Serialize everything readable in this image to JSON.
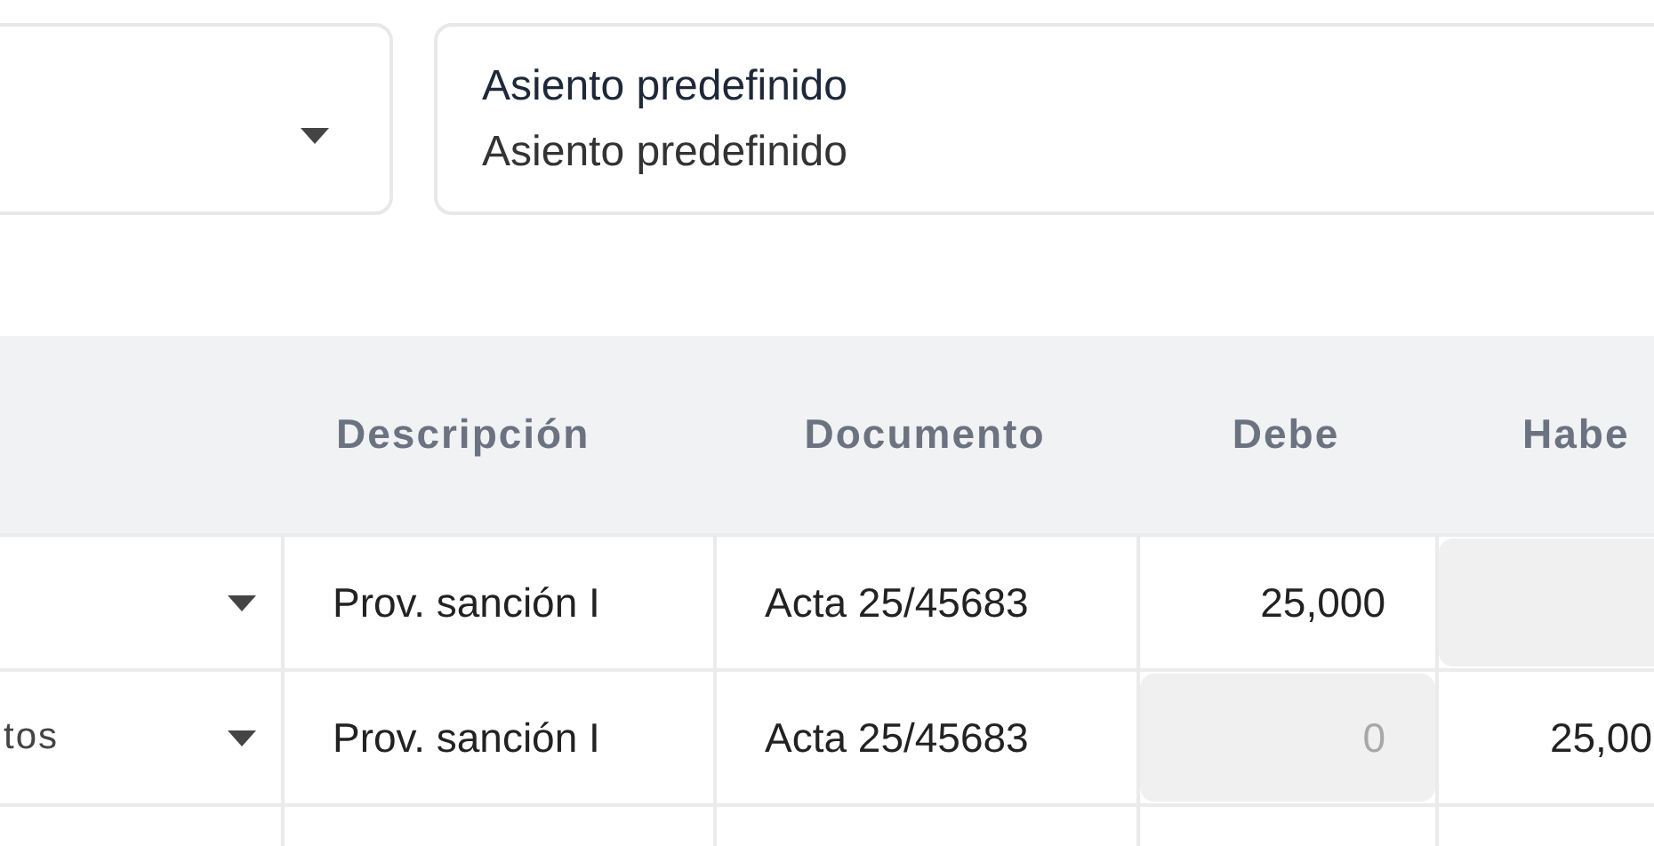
{
  "fields": [
    {
      "kind": "select"
    },
    {
      "kind": "text",
      "label": "Asiento predefinido",
      "value": "Asiento predefinido"
    }
  ],
  "table": {
    "columns": [
      {
        "kind": "blank"
      },
      {
        "kind": "text",
        "label": "Descripción"
      },
      {
        "kind": "text",
        "label": "Documento"
      },
      {
        "kind": "text",
        "label": "Debe"
      },
      {
        "kind": "text",
        "label": "Habe"
      }
    ],
    "rows": [
      {
        "cells": [
          {
            "kind": "select"
          },
          {
            "kind": "text",
            "value": "Prov. sanción I"
          },
          {
            "kind": "text",
            "value": "Acta 25/45683"
          },
          {
            "kind": "amount",
            "value": "25,000",
            "disabled": false
          },
          {
            "kind": "amount",
            "disabled": true
          }
        ]
      },
      {
        "cells": [
          {
            "kind": "select",
            "value": "tos"
          },
          {
            "kind": "text",
            "value": "Prov. sanción I"
          },
          {
            "kind": "text",
            "value": "Acta 25/45683"
          },
          {
            "kind": "amount",
            "placeholder": "0",
            "disabled": true
          },
          {
            "kind": "amount",
            "value": "25,00",
            "disabled": false
          }
        ]
      }
    ]
  }
}
